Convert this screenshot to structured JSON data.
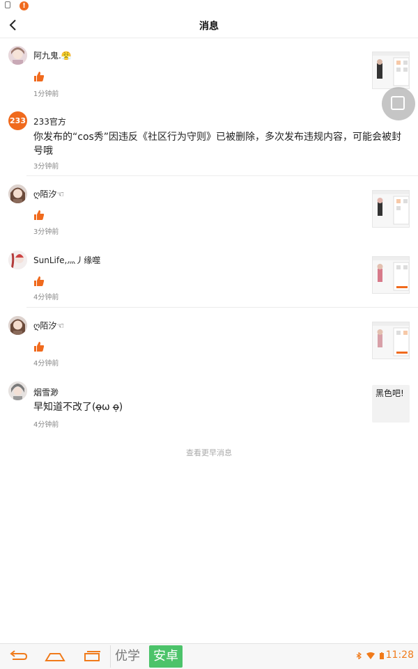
{
  "header": {
    "title": "消息"
  },
  "messages": [
    {
      "name": "阿九鬼.😤",
      "time": "1分钟前"
    },
    {
      "name": "233官方",
      "avatar_text": "233",
      "text": "你发布的“cos秀”因违反《社区行为守则》已被删除，多次发布违规内容，可能会被封号哦",
      "time": "3分钟前"
    },
    {
      "name": "ღ陌汐☜",
      "time": "3分钟前"
    },
    {
      "name": "SunLife,灬丿缘噬",
      "time": "4分钟前"
    },
    {
      "name": "ღ陌汐☜",
      "time": "4分钟前"
    },
    {
      "name": "烟雪渺",
      "text": "早知道不改了(ọ̶̶ω ọ̶̶)",
      "time": "4分钟前",
      "reply_card": "黑色吧!"
    }
  ],
  "more_label": "查看更早消息",
  "navbar": {
    "brand_a": "优学",
    "brand_b": "安卓",
    "clock": "11:28"
  },
  "colors": {
    "accent": "#f06a1d",
    "green": "#4cc36a"
  }
}
